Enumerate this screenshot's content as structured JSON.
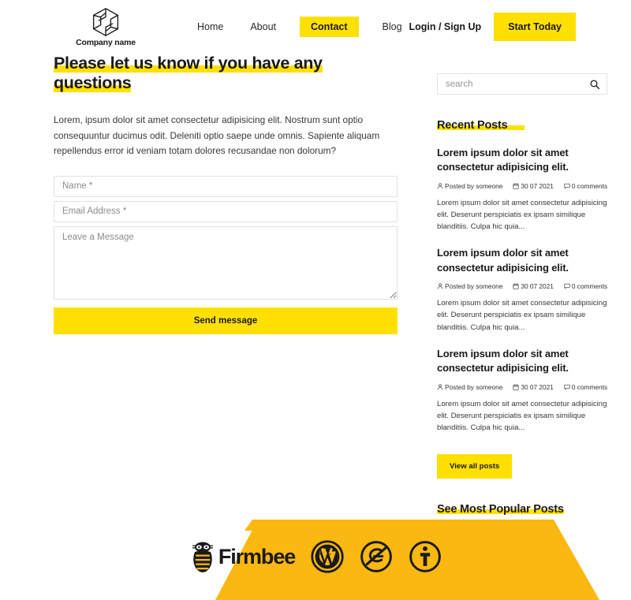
{
  "brand": {
    "name": "Company name",
    "logo_icon": "hexagon-aperture-logo"
  },
  "nav": {
    "items": [
      {
        "label": "Home",
        "active": false
      },
      {
        "label": "About",
        "active": false
      },
      {
        "label": "Contact",
        "active": true
      },
      {
        "label": "Blog",
        "active": false
      }
    ],
    "login_label": "Login / Sign Up",
    "cta_label": "Start Today"
  },
  "main": {
    "title": "Please let us know if you have any questions",
    "intro": "Lorem, ipsum dolor sit amet consectetur adipisicing elit. Nostrum sunt optio consequuntur ducimus odit. Deleniti optio saepe unde omnis. Sapiente aliquam repellendus error id veniam totam dolores recusandae non dolorum?",
    "form": {
      "name_placeholder": "Name *",
      "name_value": "",
      "email_placeholder": "Email Address *",
      "email_value": "",
      "message_placeholder": "Leave a Message",
      "message_value": "",
      "submit_label": "Send message"
    }
  },
  "sidebar": {
    "search": {
      "placeholder": "search",
      "value": "",
      "icon": "search-icon"
    },
    "recent_heading": "Recent Posts",
    "posts": [
      {
        "title": "Lorem ipsum dolor sit amet consectetur adipisicing elit.",
        "author": "Posted by someone",
        "date": "30 07 2021",
        "comments": "0 comments",
        "excerpt": "Lorem ipsum dolor sit amet consectetur adipisicing elit. Deserunt perspiciatis ex ipsam similique blanditiis. Culpa hic quia..."
      },
      {
        "title": "Lorem ipsum dolor sit amet consectetur adipisicing elit.",
        "author": "Posted by someone",
        "date": "30 07 2021",
        "comments": "0 comments",
        "excerpt": "Lorem ipsum dolor sit amet consectetur adipisicing elit. Deserunt perspiciatis ex ipsam similique blanditiis. Culpa hic quia..."
      },
      {
        "title": "Lorem ipsum dolor sit amet consectetur adipisicing elit.",
        "author": "Posted by someone",
        "date": "30 07 2021",
        "comments": "0 comments",
        "excerpt": "Lorem ipsum dolor sit amet consectetur adipisicing elit. Deserunt perspiciatis ex ipsam similique blanditiis. Culpa hic quia..."
      }
    ],
    "view_all_label": "View all posts",
    "popular_heading": "See Most Popular Posts"
  },
  "footer": {
    "firmbee_word": "Firmbee",
    "logos": [
      "firmbee-bee-icon",
      "wordpress-icon",
      "envato-elements-icon",
      "accessibility-icon"
    ]
  },
  "colors": {
    "accent_yellow": "#FFE000",
    "footer_gold": "#FBB810",
    "text": "#1b1a18",
    "border": "#e2e2e2"
  }
}
